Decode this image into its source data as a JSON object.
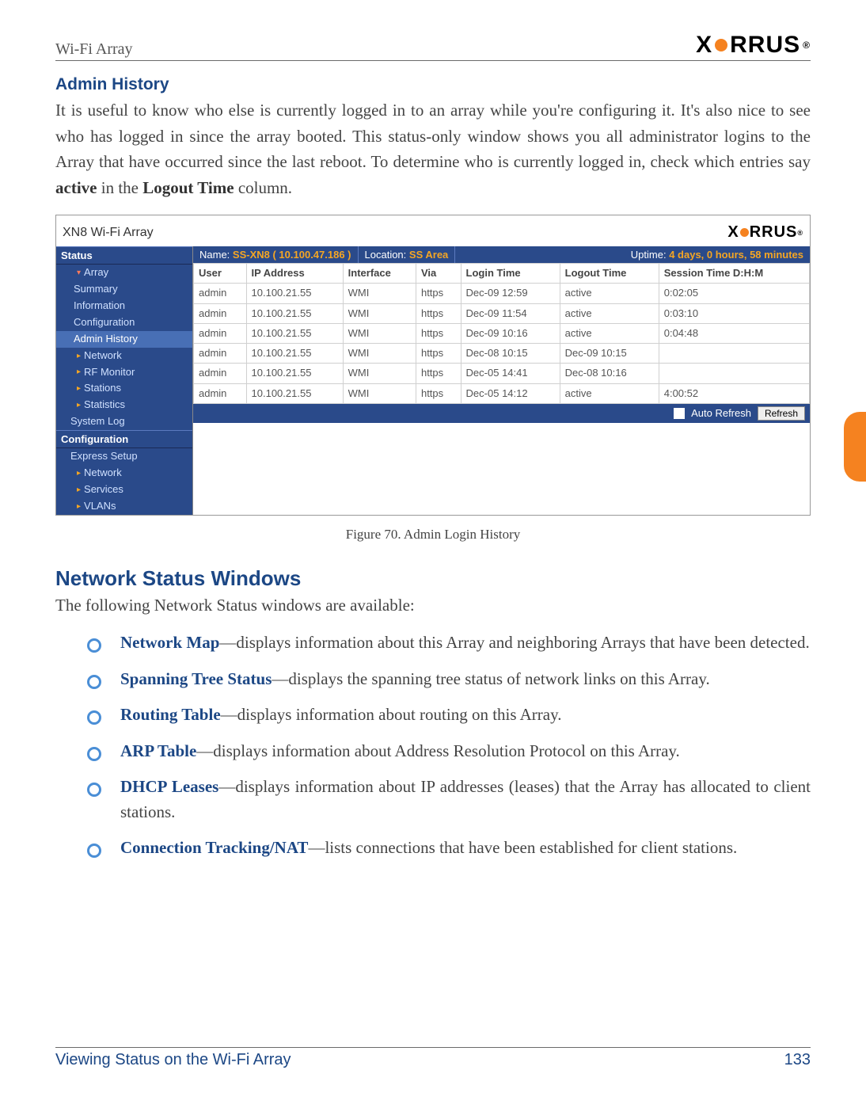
{
  "header": {
    "label": "Wi-Fi Array",
    "brand_pre": "X",
    "brand_post": "RRUS",
    "reg": "®"
  },
  "section1": {
    "title": "Admin History",
    "paragraph_pre": "It is useful to know who else is currently logged in to an array while you're configuring it. It's also nice to see who has logged in since the array booted. This status-only window shows you all administrator logins to the Array that have occurred since the last reboot. To determine who is currently logged in, check which entries say ",
    "bold1": "active",
    "mid": " in the ",
    "bold2": "Logout Time",
    "post": " column."
  },
  "screenshot": {
    "title": "XN8 Wi-Fi Array",
    "nav": {
      "status_hd": "Status",
      "array": "Array",
      "summary": "Summary",
      "information": "Information",
      "configuration": "Configuration",
      "admin_history": "Admin History",
      "network": "Network",
      "rf_monitor": "RF Monitor",
      "stations": "Stations",
      "statistics": "Statistics",
      "system_log": "System Log",
      "config_hd": "Configuration",
      "express_setup": "Express Setup",
      "cfg_network": "Network",
      "services": "Services",
      "vlans": "VLANs"
    },
    "info": {
      "name_label": "Name:",
      "name_value": "SS-XN8   ( 10.100.47.186 )",
      "location_label": "Location:",
      "location_value": "SS Area",
      "uptime_label": "Uptime:",
      "uptime_value": "4 days, 0 hours, 58 minutes"
    },
    "table": {
      "headers": {
        "user": "User",
        "ip": "IP Address",
        "iface": "Interface",
        "via": "Via",
        "login": "Login Time",
        "logout": "Logout Time",
        "session": "Session Time D:H:M"
      },
      "rows": [
        {
          "user": "admin",
          "ip": "10.100.21.55",
          "iface": "WMI",
          "via": "https",
          "login": "Dec-09 12:59",
          "logout": "active",
          "session": "0:02:05"
        },
        {
          "user": "admin",
          "ip": "10.100.21.55",
          "iface": "WMI",
          "via": "https",
          "login": "Dec-09 11:54",
          "logout": "active",
          "session": "0:03:10"
        },
        {
          "user": "admin",
          "ip": "10.100.21.55",
          "iface": "WMI",
          "via": "https",
          "login": "Dec-09 10:16",
          "logout": "active",
          "session": "0:04:48"
        },
        {
          "user": "admin",
          "ip": "10.100.21.55",
          "iface": "WMI",
          "via": "https",
          "login": "Dec-08 10:15",
          "logout": "Dec-09 10:15",
          "session": ""
        },
        {
          "user": "admin",
          "ip": "10.100.21.55",
          "iface": "WMI",
          "via": "https",
          "login": "Dec-05 14:41",
          "logout": "Dec-08 10:16",
          "session": ""
        },
        {
          "user": "admin",
          "ip": "10.100.21.55",
          "iface": "WMI",
          "via": "https",
          "login": "Dec-05 14:12",
          "logout": "active",
          "session": "4:00:52"
        }
      ]
    },
    "footer": {
      "auto_refresh": "Auto Refresh",
      "refresh": "Refresh"
    }
  },
  "figure_caption": "Figure 70. Admin Login History",
  "section2": {
    "title": "Network Status Windows",
    "intro": "The following Network Status windows are available:",
    "items": [
      {
        "link": "Network Map",
        "rest": "—displays information about this Array and neighboring Arrays that have been detected."
      },
      {
        "link": "Spanning Tree Status",
        "rest": "—displays the spanning tree status of network links on this Array."
      },
      {
        "link": "Routing Table",
        "rest": "—displays information about routing on this Array."
      },
      {
        "link": "ARP Table",
        "rest": "—displays information about Address Resolution Protocol on this Array."
      },
      {
        "link": "DHCP Leases",
        "rest": "—displays information about IP addresses (leases) that the Array has allocated to client stations."
      },
      {
        "link": "Connection Tracking/NAT",
        "rest": "—lists connections that have been established for client stations."
      }
    ]
  },
  "footer": {
    "section": "Viewing Status on the Wi-Fi Array",
    "page": "133"
  }
}
